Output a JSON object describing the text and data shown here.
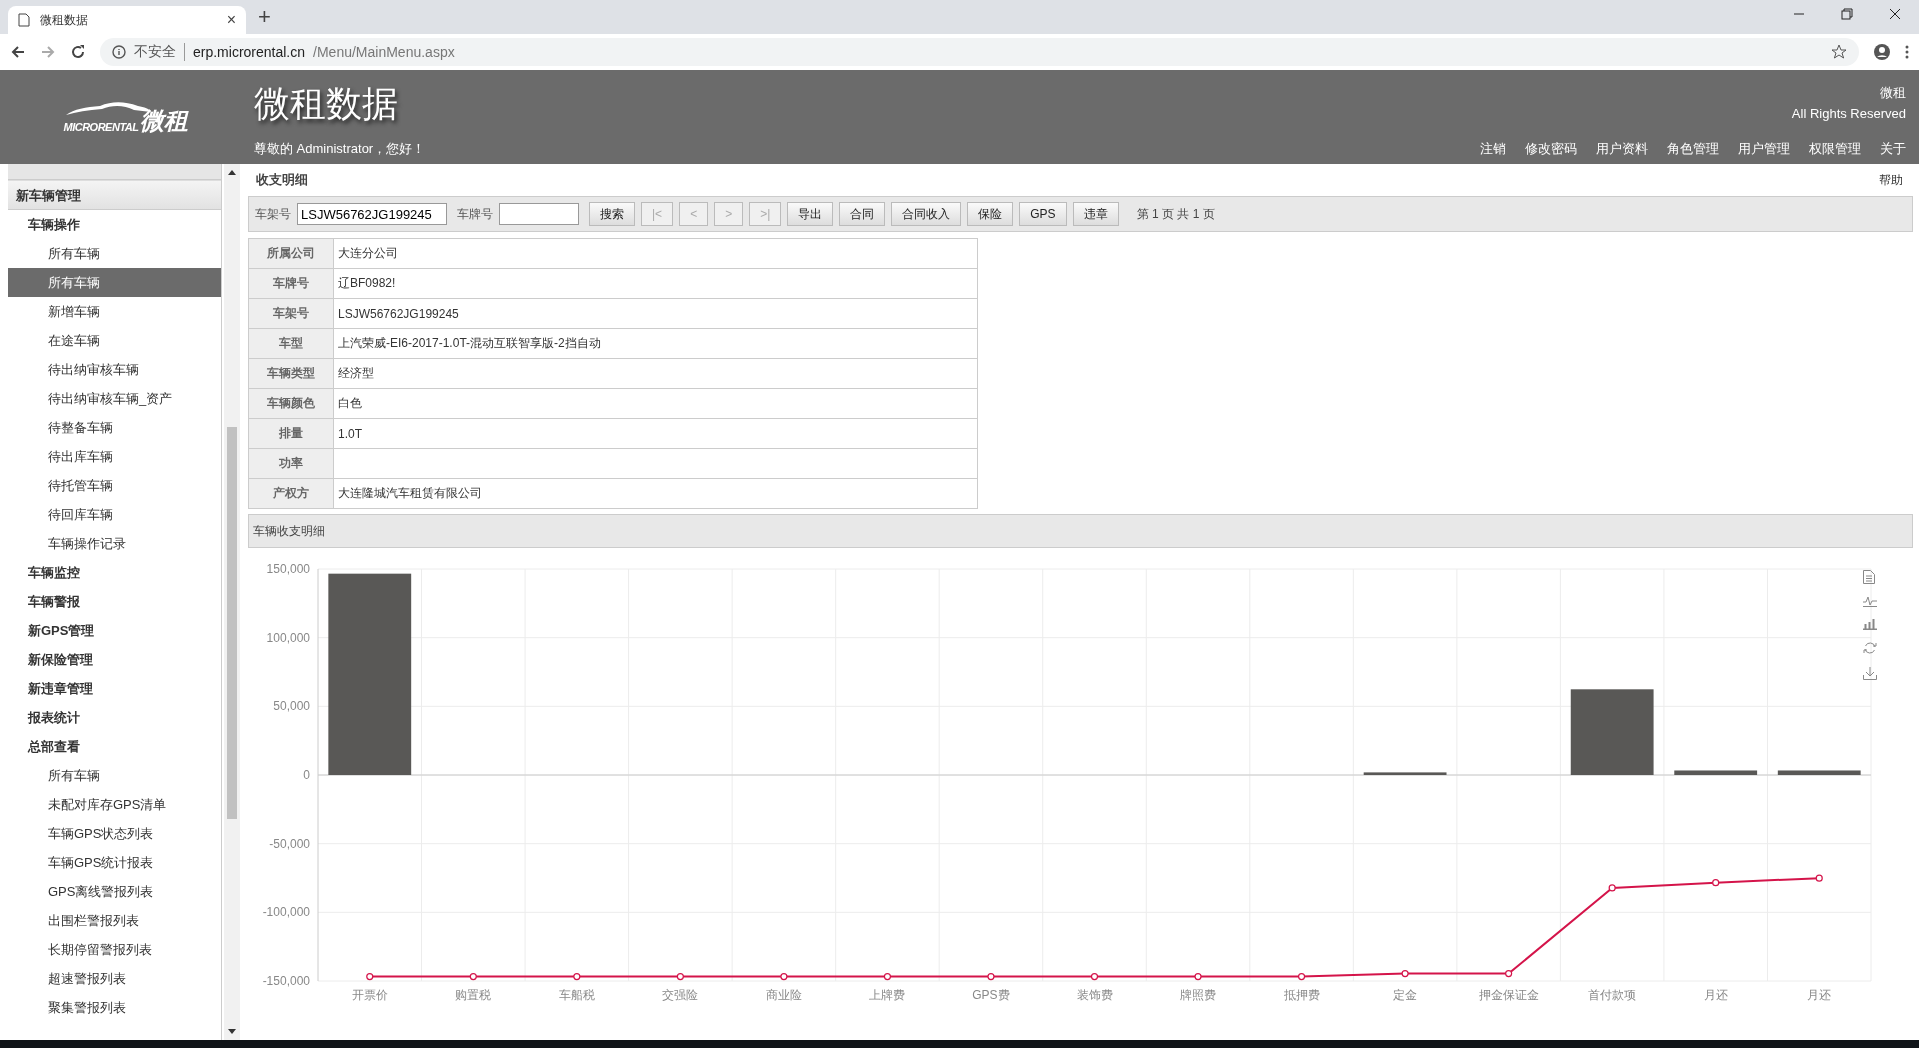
{
  "browser": {
    "tab_title": "微租数据",
    "tab_close": "×",
    "new_tab": "+",
    "security": "不安全",
    "url_host": "erp.microrental.cn",
    "url_path": "/Menu/MainMenu.aspx"
  },
  "header": {
    "logo_text": "MICRORENTAL",
    "logo_cn": "微租",
    "title": "微租数据",
    "greeting": "尊敬的 Administrator，您好！",
    "company": "微租",
    "rights": "All Rights Reserved",
    "nav": [
      "注销",
      "修改密码",
      "用户资料",
      "角色管理",
      "用户管理",
      "权限管理",
      "关于"
    ]
  },
  "sidebar": {
    "items": [
      {
        "label": "新车辆管理",
        "selected": false,
        "children": [
          {
            "label": "车辆操作",
            "selected": false,
            "children": [
              {
                "label": "所有车辆",
                "selected": false
              },
              {
                "label": "所有车辆",
                "selected": true
              },
              {
                "label": "新增车辆",
                "selected": false
              },
              {
                "label": "在途车辆",
                "selected": false
              },
              {
                "label": "待出纳审核车辆",
                "selected": false
              },
              {
                "label": "待出纳审核车辆_资产",
                "selected": false
              },
              {
                "label": "待整备车辆",
                "selected": false
              },
              {
                "label": "待出库车辆",
                "selected": false
              },
              {
                "label": "待托管车辆",
                "selected": false
              },
              {
                "label": "待回库车辆",
                "selected": false
              },
              {
                "label": "车辆操作记录",
                "selected": false
              }
            ]
          },
          {
            "label": "车辆监控",
            "selected": false
          },
          {
            "label": "车辆警报",
            "selected": false
          },
          {
            "label": "新GPS管理",
            "selected": false
          },
          {
            "label": "新保险管理",
            "selected": false
          },
          {
            "label": "新违章管理",
            "selected": false
          },
          {
            "label": "报表统计",
            "selected": false
          },
          {
            "label": "总部查看",
            "selected": false,
            "children": [
              {
                "label": "所有车辆",
                "selected": false
              },
              {
                "label": "未配对库存GPS清单",
                "selected": false
              },
              {
                "label": "车辆GPS状态列表",
                "selected": false
              },
              {
                "label": "车辆GPS统计报表",
                "selected": false
              },
              {
                "label": "GPS离线警报列表",
                "selected": false
              },
              {
                "label": "出围栏警报列表",
                "selected": false
              },
              {
                "label": "长期停留警报列表",
                "selected": false
              },
              {
                "label": "超速警报列表",
                "selected": false
              },
              {
                "label": "聚集警报列表",
                "selected": false
              }
            ]
          }
        ]
      }
    ]
  },
  "panel": {
    "title": "收支明细",
    "help": "帮助",
    "toolbar": {
      "vin_label": "车架号",
      "vin_value": "LSJW56762JG199245",
      "plate_label": "车牌号",
      "buttons": [
        {
          "label": "搜索",
          "disabled": false
        },
        {
          "label": "|<",
          "disabled": true
        },
        {
          "label": "<",
          "disabled": true
        },
        {
          "label": ">",
          "disabled": true
        },
        {
          "label": ">|",
          "disabled": true
        },
        {
          "label": "导出",
          "disabled": false
        },
        {
          "label": "合同",
          "disabled": false
        },
        {
          "label": "合同收入",
          "disabled": false
        },
        {
          "label": "保险",
          "disabled": false
        },
        {
          "label": "GPS",
          "disabled": false
        },
        {
          "label": "违章",
          "disabled": false
        }
      ],
      "page_info": "第 1 页 共 1 页"
    },
    "details": [
      {
        "label": "所属公司",
        "value": "大连分公司"
      },
      {
        "label": "车牌号",
        "value": "辽BF0982!"
      },
      {
        "label": "车架号",
        "value": "LSJW56762JG199245"
      },
      {
        "label": "车型",
        "value": "上汽荣威-EI6-2017-1.0T-混动互联智享版-2挡自动"
      },
      {
        "label": "车辆类型",
        "value": "经济型"
      },
      {
        "label": "车辆颜色",
        "value": "白色"
      },
      {
        "label": "排量",
        "value": "1.0T"
      },
      {
        "label": "功率"
      },
      {
        "label": "产权方",
        "value": "大连隆城汽车租赁有限公司"
      }
    ],
    "section": "车辆收支明细",
    "chart_data": {
      "type": "bar",
      "categories": [
        "开票价",
        "购置税",
        "车船税",
        "交强险",
        "商业险",
        "上牌费",
        "GPS费",
        "装饰费",
        "牌照费",
        "抵押费",
        "定金",
        "押金保证金",
        "首付款项",
        "月还",
        "月还"
      ],
      "series": [
        {
          "type": "bar",
          "color": "#595856",
          "values": [
            146600,
            0,
            0,
            0,
            0,
            0,
            0,
            0,
            0,
            0,
            1900,
            0,
            62400,
            3300,
            3300
          ]
        },
        {
          "type": "line",
          "marker": "circle",
          "color": "#d4144a",
          "values": [
            -146800,
            -146800,
            -146800,
            -146800,
            -146800,
            -146800,
            -146800,
            -146800,
            -146800,
            -146800,
            -144600,
            -144600,
            -82200,
            -78400,
            -75100
          ]
        }
      ],
      "grid": true,
      "ylim": [
        -150000,
        150000
      ],
      "yticks": [
        {
          "value": -150000,
          "label": "-150,000"
        },
        {
          "value": -100000,
          "label": "-100,000"
        },
        {
          "value": -50000,
          "label": "-50,000"
        },
        {
          "value": 0,
          "label": "0"
        },
        {
          "value": 50000,
          "label": "50,000"
        },
        {
          "value": 100000,
          "label": "100,000"
        },
        {
          "value": 150000,
          "label": "150,000"
        }
      ]
    }
  }
}
